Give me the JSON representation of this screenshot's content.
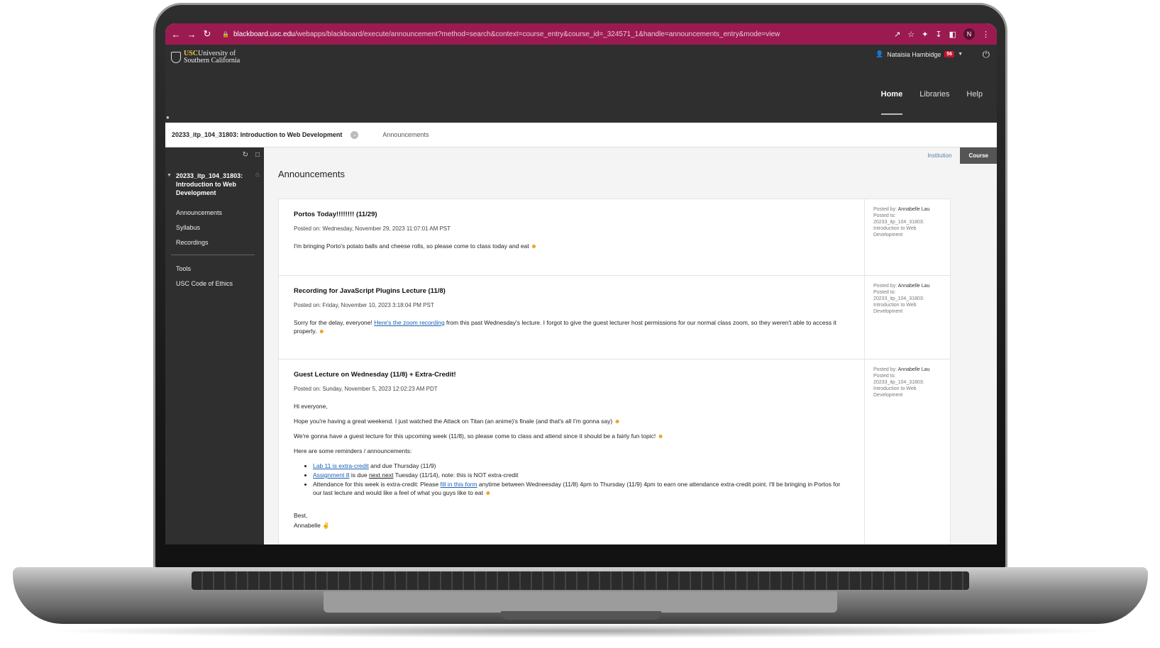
{
  "browser": {
    "url_host": "blackboard.usc.edu",
    "url_rest": "/webapps/blackboard/execute/announcement?method=search&context=course_entry&course_id=_324571_1&handle=announcements_entry&mode=view",
    "profile_initial": "N"
  },
  "header": {
    "logo_usc": "USC",
    "logo_line1": "University of",
    "logo_line2": "Southern California",
    "user_name": "Nataisia Hambidge",
    "notification_count": "56",
    "nav": [
      {
        "label": "Home",
        "active": true
      },
      {
        "label": "Libraries",
        "active": false
      },
      {
        "label": "Help",
        "active": false
      }
    ]
  },
  "breadcrumb": {
    "course": "20233_itp_104_31803: Introduction to Web Development",
    "current": "Announcements"
  },
  "sidebar": {
    "course_title": "20233_itp_104_31803: Introduction to Web Development",
    "items": [
      "Announcements",
      "Syllabus",
      "Recordings"
    ],
    "items2": [
      "Tools",
      "USC Code of Ethics"
    ]
  },
  "context_tabs": {
    "institution": "Institution",
    "course": "Course"
  },
  "page_title": "Announcements",
  "announcements": [
    {
      "title": "Portos Today!!!!!!!! (11/29)",
      "posted_on": "Posted on: Wednesday, November 29, 2023 11:07:01 AM PST",
      "body": "I'm bringing Porto's potato balls and cheese rolls, so please come to class today and eat",
      "posted_by_label": "Posted by:",
      "posted_by": "Annabelle Lau",
      "posted_to_label": "Posted to:",
      "posted_to": "20233_itp_104_31803: Introduction to Web Development"
    },
    {
      "title": "Recording for JavaScript Plugins Lecture (11/8)",
      "posted_on": "Posted on: Friday, November 10, 2023 3:18:04 PM PST",
      "body_pre": "Sorry for the delay, everyone!",
      "body_link": "Here's the zoom recording",
      "body_post": "from this past Wednesday's lecture. I forgot to give the guest lecturer host permissions for our normal class zoom, so they weren't able to access it properly.",
      "posted_by_label": "Posted by:",
      "posted_by": "Annabelle Lau",
      "posted_to_label": "Posted to:",
      "posted_to": "20233_itp_104_31803: Introduction to Web Development"
    },
    {
      "title": "Guest Lecture on Wednesday (11/8) + Extra-Credit!",
      "posted_on": "Posted on: Sunday, November 5, 2023 12:02:23 AM PDT",
      "greeting": "Hi everyone,",
      "para1": "Hope you're having a great weekend. I just watched the Attack on Titan (an anime)'s finale (and that's all I'm gonna say)",
      "para2": "We're gonna have a guest lecture for this upcoming week (11/8), so please come to class and attend since it should be a fairly fun topic!",
      "para3": "Here are some reminders / announcements:",
      "li1_link": "Lab 11 is extra-credit",
      "li1_post": "and due Thursday (11/9)",
      "li2_link": "Assignment 8",
      "li2_mid": "is due",
      "li2_u": "next next",
      "li2_post": "Tuesday (11/14), note: this is NOT extra-credit",
      "li3_pre": "Attendance for this week is extra-credit: Please",
      "li3_link": "fill in this form",
      "li3_post": "anytime between Wedneesday (11/8) 4pm to Thursday (11/9) 4pm to earn one attendance extra-credit point. I'll be bringing in Portos for our last lecture and would like a feel of what you guys like to eat",
      "signoff": "Best,",
      "signature": "Annabelle",
      "posted_by_label": "Posted by:",
      "posted_by": "Annabelle Lau",
      "posted_to_label": "Posted to:",
      "posted_to": "20233_itp_104_31803: Introduction to Web Development"
    }
  ],
  "colors": {
    "browser_bar": "#9b1b50",
    "bb_dark": "#2f2f2f",
    "link": "#1a5fb4",
    "badge": "#c8102e"
  }
}
